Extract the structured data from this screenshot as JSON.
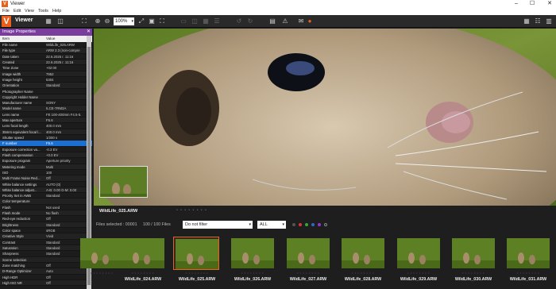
{
  "window": {
    "title": "Viewer",
    "app_icon": "V",
    "min": "–",
    "max": "☐",
    "close": "✕"
  },
  "menu": [
    "File",
    "Edit",
    "View",
    "Tools",
    "Help"
  ],
  "toolbar": {
    "logo": "V",
    "viewer_label": "Viewer",
    "zoom": "100%"
  },
  "panel": {
    "title": "Image Properties",
    "close": "✕",
    "col_item": "Item",
    "col_value": "Value",
    "rows": [
      {
        "k": "File name",
        "v": "WildLife_025.ARW"
      },
      {
        "k": "File type",
        "v": "ARW 2.3 (non-compre"
      },
      {
        "k": "Date taken",
        "v": "22.6.2025 r. 11:16"
      },
      {
        "k": "Created",
        "v": "22.6.2025 r. 11:16"
      },
      {
        "k": "Time Zone",
        "v": "+02:00"
      },
      {
        "k": "Image width",
        "v": "7952"
      },
      {
        "k": "Image height",
        "v": "5304"
      },
      {
        "k": "Orientation",
        "v": "Standard"
      },
      {
        "k": "Photographer Name",
        "v": ""
      },
      {
        "k": "Copyright Holder Name",
        "v": ""
      },
      {
        "k": "Manufacturer name",
        "v": "SONY"
      },
      {
        "k": "Model name",
        "v": "ILCE-7RM3A"
      },
      {
        "k": "Lens name",
        "v": "FE 100-400mm F4.5-5."
      },
      {
        "k": "Max aperture",
        "v": "F5.6"
      },
      {
        "k": "Lens focal length",
        "v": "400.0 mm"
      },
      {
        "k": "35mm equivalent focal l...",
        "v": "400.0 mm"
      },
      {
        "k": "Shutter speed",
        "v": "1/200 s"
      },
      {
        "k": "F number",
        "v": "F5.6"
      },
      {
        "k": "Exposure correction va...",
        "v": "-0.3 EV"
      },
      {
        "k": "Flash compensation",
        "v": "+0.0 EV"
      },
      {
        "k": "Exposure program",
        "v": "Aperture priority"
      },
      {
        "k": "Metering mode",
        "v": "Multi"
      },
      {
        "k": "ISO",
        "v": "100"
      },
      {
        "k": "Multi Frame Noise Red...",
        "v": "Off"
      },
      {
        "k": "White balance settings",
        "v": "AUTO (0)"
      },
      {
        "k": "White balance adjust...",
        "v": "A-B: 0.00 G-M: 0.00"
      },
      {
        "k": "Priority Set in AWB",
        "v": "Standard"
      },
      {
        "k": "Color temperature",
        "v": ""
      },
      {
        "k": "Flash",
        "v": "Not used"
      },
      {
        "k": "Flash mode",
        "v": "No flash"
      },
      {
        "k": "Red-eye reduction",
        "v": "Off"
      },
      {
        "k": "Brightness",
        "v": "Standard"
      },
      {
        "k": "Color space",
        "v": "sRGB"
      },
      {
        "k": "Creative Style",
        "v": "Vivid"
      },
      {
        "k": "Contrast",
        "v": "Standard"
      },
      {
        "k": "Saturation",
        "v": "Standard"
      },
      {
        "k": "Sharpness",
        "v": "Standard"
      },
      {
        "k": "Scene selection",
        "v": ""
      },
      {
        "k": "Zone matching",
        "v": "Off"
      },
      {
        "k": "D-Range Optimizer",
        "v": "Auto"
      },
      {
        "k": "High HDR",
        "v": "Off"
      },
      {
        "k": "High ISO NR",
        "v": "Off"
      }
    ],
    "selected_index": 17
  },
  "viewer": {
    "file_name": "WildLife_025.ARW",
    "dots": "• • • • • • • •"
  },
  "files": {
    "selected": "Files selected : 00001",
    "count": "100 / 100 Files",
    "filter": "Do not filter",
    "filter_arrow": "▾",
    "all": "ALL",
    "all_arrow": "▾"
  },
  "thumbnails": [
    {
      "label": "",
      "dots": "• • • • • • • •"
    },
    {
      "label": "WildLife_024.ARW",
      "dots": "• • • • • • • •"
    },
    {
      "label": "WildLife_025.ARW",
      "dots": "• • • • • • • •",
      "selected": true
    },
    {
      "label": "WildLife_026.ARW",
      "dots": "• • • • • • • •"
    },
    {
      "label": "WildLife_027.ARW",
      "dots": "• • • • • • • •"
    },
    {
      "label": "WildLife_028.ARW",
      "dots": "• • • • • • • •"
    },
    {
      "label": "WildLife_029.ARW",
      "dots": "• • • • • • • •"
    },
    {
      "label": "WildLife_030.ARW",
      "dots": "• • • • • • • •"
    },
    {
      "label": "WildLife_031.ARW",
      "dots": "• • • • • • • •"
    }
  ],
  "colors": {
    "accent": "#e8601c",
    "panel_header": "#7a3d9e",
    "selection": "#1a6fd0",
    "label_red": "#d33",
    "label_green": "#3a3",
    "label_blue": "#36c",
    "label_purple": "#93c"
  }
}
